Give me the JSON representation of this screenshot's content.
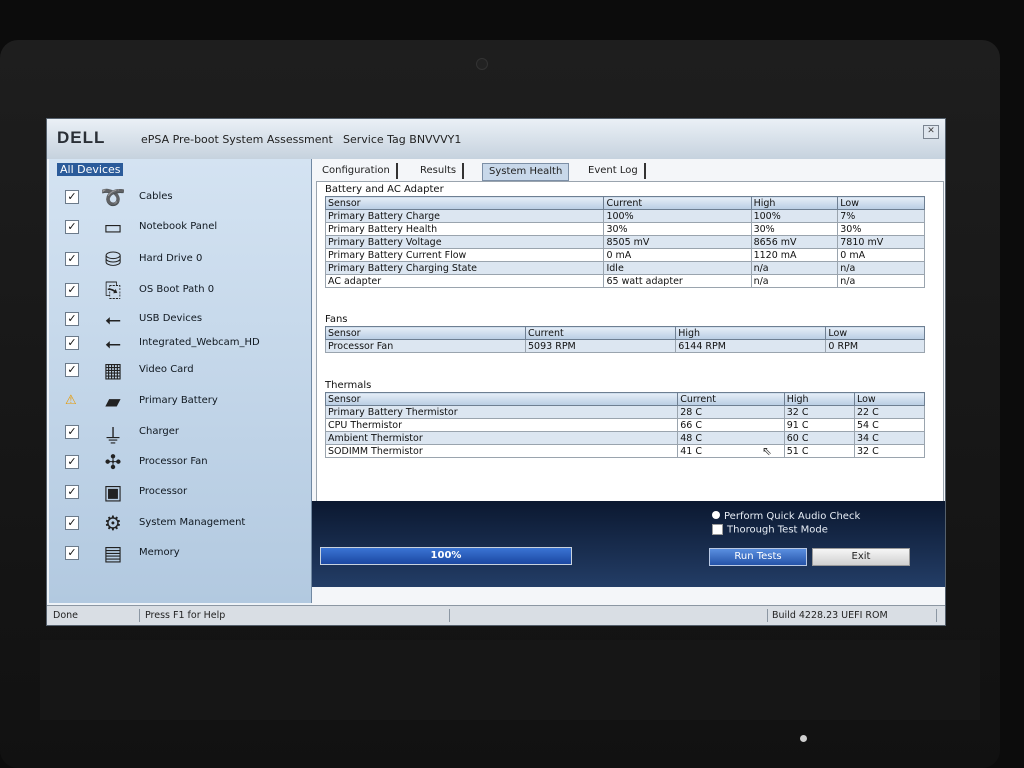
{
  "app": {
    "brand": "DELL",
    "title": "ePSA Pre-boot System Assessment",
    "service_tag": "Service Tag BNVVVY1"
  },
  "sidebar": {
    "header": "All Devices",
    "items": [
      {
        "label": "Cables",
        "status": "pass",
        "icon": "cable-icon"
      },
      {
        "label": "Notebook Panel",
        "status": "pass",
        "icon": "monitor-icon"
      },
      {
        "label": "Hard Drive 0",
        "status": "pass",
        "icon": "hard-drive-icon"
      },
      {
        "label": "OS Boot Path 0",
        "status": "pass",
        "icon": "boot-path-icon"
      },
      {
        "label": "USB Devices",
        "status": "pass",
        "icon": "usb-icon"
      },
      {
        "label": "Integrated_Webcam_HD",
        "status": "pass",
        "icon": "usb-icon"
      },
      {
        "label": "Video Card",
        "status": "pass",
        "icon": "video-card-icon"
      },
      {
        "label": "Primary Battery",
        "status": "warning",
        "icon": "battery-icon"
      },
      {
        "label": "Charger",
        "status": "pass",
        "icon": "charger-icon"
      },
      {
        "label": "Processor Fan",
        "status": "pass",
        "icon": "fan-icon"
      },
      {
        "label": "Processor",
        "status": "pass",
        "icon": "processor-icon"
      },
      {
        "label": "System Management",
        "status": "pass",
        "icon": "system-management-icon"
      },
      {
        "label": "Memory",
        "status": "pass",
        "icon": "memory-icon"
      }
    ]
  },
  "tabs": [
    "Configuration",
    "Results",
    "System Health",
    "Event Log"
  ],
  "active_tab": "System Health",
  "sections": {
    "battery": {
      "title": "Battery and AC Adapter",
      "headers": [
        "Sensor",
        "Current",
        "High",
        "Low"
      ],
      "rows": [
        [
          "Primary Battery Charge",
          "100%",
          "100%",
          "7%"
        ],
        [
          "Primary Battery Health",
          "30%",
          "30%",
          "30%"
        ],
        [
          "Primary Battery Voltage",
          "8505 mV",
          "8656 mV",
          "7810 mV"
        ],
        [
          "Primary Battery Current Flow",
          "0 mA",
          "1120 mA",
          "0 mA"
        ],
        [
          "Primary Battery Charging State",
          "Idle",
          "n/a",
          "n/a"
        ],
        [
          "AC adapter",
          "65 watt adapter",
          "n/a",
          "n/a"
        ]
      ]
    },
    "fans": {
      "title": "Fans",
      "headers": [
        "Sensor",
        "Current",
        "High",
        "Low"
      ],
      "rows": [
        [
          "Processor Fan",
          "5093 RPM",
          "6144 RPM",
          "0 RPM"
        ]
      ]
    },
    "thermals": {
      "title": "Thermals",
      "headers": [
        "Sensor",
        "Current",
        "High",
        "Low"
      ],
      "rows": [
        [
          "Primary Battery Thermistor",
          "28 C",
          "32 C",
          "22 C"
        ],
        [
          "CPU Thermistor",
          "66 C",
          "91 C",
          "54 C"
        ],
        [
          "Ambient Thermistor",
          "48 C",
          "60 C",
          "34 C"
        ],
        [
          "SODIMM Thermistor",
          "41 C",
          "51 C",
          "32 C"
        ]
      ]
    }
  },
  "options": {
    "quick_audio": "Perform Quick Audio Check",
    "thorough": "Thorough Test Mode"
  },
  "progress": {
    "label": "100%",
    "value": 1.0
  },
  "buttons": {
    "run": "Run Tests",
    "exit": "Exit"
  },
  "status_bar": {
    "state": "Done",
    "help": "Press F1 for Help",
    "build": "Build 4228.23 UEFI ROM"
  },
  "colors": {
    "accent": "#2b5b9a",
    "warning": "#e89900",
    "band": "#233d66"
  }
}
